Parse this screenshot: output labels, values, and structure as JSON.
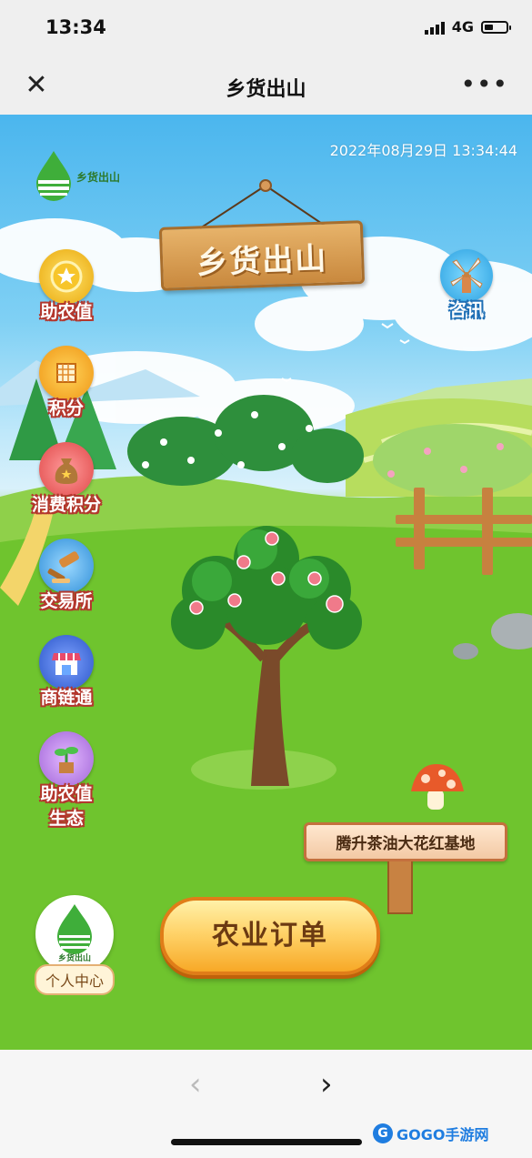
{
  "status_bar": {
    "time": "13:34",
    "network": "4G"
  },
  "nav": {
    "close_icon": "close-icon",
    "title": "乡货出山",
    "more_icon": "more-icon"
  },
  "game": {
    "datetime": "2022年08月29日 13:34:44",
    "brand_text": "乡货出山",
    "sign_title": "乡货出山",
    "side_menu": [
      {
        "label": "助农值",
        "icon": "star-coin-icon",
        "color": "#f4c21c"
      },
      {
        "label": "积分",
        "icon": "points-icon",
        "color": "#f5a623"
      },
      {
        "label": "消费积分",
        "icon": "money-bag-icon",
        "color": "#e85a5a"
      },
      {
        "label": "交易所",
        "icon": "gavel-icon",
        "color": "#3aa0e6"
      },
      {
        "label": "商链通",
        "icon": "shop-icon",
        "color": "#3c6fd6"
      },
      {
        "label": "助农值",
        "label2": "生态",
        "icon": "seedling-icon",
        "color": "#b07ad8"
      }
    ],
    "news": {
      "label": "咨讯",
      "icon": "windmill-icon"
    },
    "base_sign": "腾升茶油大花红基地",
    "order_button": "农业订单",
    "profile": {
      "label": "个人中心",
      "brand_text": "乡货出山"
    }
  },
  "bottom": {
    "prev_icon": "chevron-left-icon",
    "next_icon": "chevron-right-icon",
    "watermark": "GOGO手游网"
  }
}
